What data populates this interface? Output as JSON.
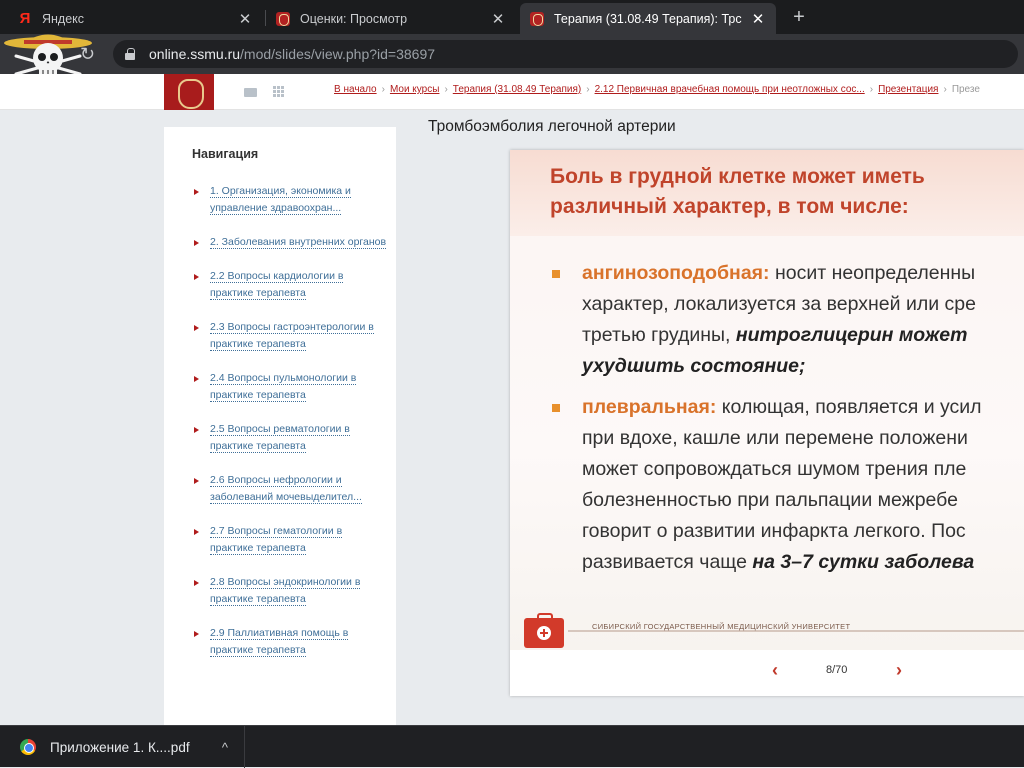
{
  "browser": {
    "tabs": [
      {
        "title": "Яндекс",
        "favicon": "yandex-icon",
        "active": false
      },
      {
        "title": "Оценки: Просмотр",
        "favicon": "ssmu-crest-icon",
        "active": false
      },
      {
        "title": "Терапия (31.08.49 Терапия): Трс",
        "favicon": "ssmu-crest-icon",
        "active": true
      }
    ],
    "tab_close_glyph": "✕",
    "new_tab_glyph": "+",
    "url_host": "online.ssmu.ru",
    "url_path": "/mod/slides/view.php?id=38697"
  },
  "breadcrumb": [
    "В начало",
    "Мои курсы",
    "Терапия (31.08.49 Терапия)",
    "2.12 Первичная врачебная помощь при неотложных сос...",
    "Презентация",
    "Презе"
  ],
  "breadcrumb_separator": "›",
  "navigation": {
    "title": "Навигация",
    "items": [
      "1. Организация, экономика и управление здравоохран...",
      "2. Заболевания внутренних органов",
      "2.2 Вопросы кардиологии в практике терапевта",
      "2.3 Вопросы гастроэнтерологии в практике терапевта",
      "2.4 Вопросы пульмонологии в практике терапевта",
      "2.5 Вопросы ревматологии в практике терапевта",
      "2.6 Вопросы нефрологии и заболеваний мочевыделител...",
      "2.7 Вопросы гематологии в практике терапевта",
      "2.8 Вопросы эндокринологии в практике терапевта",
      "2.9 Паллиативная помощь в практике терапевта"
    ]
  },
  "main": {
    "title": "Тромбоэмболия легочной артерии"
  },
  "slide": {
    "heading_line1": "Боль в грудной клетке может иметь",
    "heading_line2": "различный характер, в том числе:",
    "bullet1": {
      "term": "ангинозоподобная:",
      "line1_rest": " носит неопределенны",
      "line2": "характер, локализуется за верхней или сре",
      "line3_plain": "третью грудины, ",
      "line3_emph": "нитроглицерин может",
      "line4_emph": "ухудшить состояние;"
    },
    "bullet2": {
      "term": "плевральная:",
      "line1_rest": " колющая, появляется и усил",
      "line2": "при вдохе, кашле или перемене положени",
      "line3": "может сопровождаться шумом трения пле",
      "line4": "болезненностью при пальпации межребе",
      "line5": "говорит о развитии инфаркта легкого. Пос",
      "line6_plain": "развивается чаще ",
      "line6_emph": "на 3–7 сутки заболева"
    },
    "footer_text": "Сибирский государственный медицинский университет"
  },
  "pager": {
    "prev_glyph": "‹",
    "next_glyph": "›",
    "current": 8,
    "total": 70,
    "label": "8/70"
  },
  "downloads": {
    "file_name": "Приложение 1. К....pdf",
    "chevron_glyph": "^"
  },
  "colors": {
    "brand_red": "#b01c1c",
    "slide_heading": "#c0442b",
    "term_orange": "#d9732b",
    "link_blue": "#3f6f98"
  }
}
